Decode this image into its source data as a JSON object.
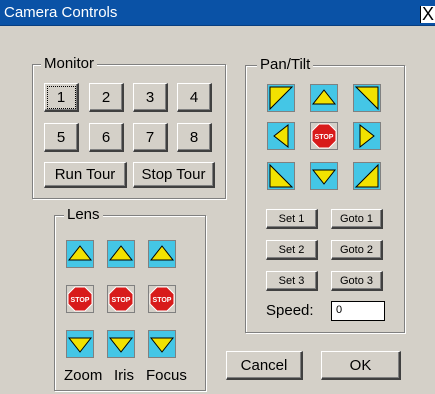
{
  "window": {
    "title": "Camera Controls",
    "close_label": "X"
  },
  "monitor": {
    "label": "Monitor",
    "buttons": [
      "1",
      "2",
      "3",
      "4",
      "5",
      "6",
      "7",
      "8"
    ],
    "run_tour": "Run Tour",
    "stop_tour": "Stop Tour"
  },
  "pantilt": {
    "label": "Pan/Tilt",
    "stop_text": "STOP",
    "set1": "Set 1",
    "goto1": "Goto 1",
    "set2": "Set 2",
    "goto2": "Goto 2",
    "set3": "Set 3",
    "goto3": "Goto 3",
    "speed_label": "Speed:",
    "speed_value": "0"
  },
  "lens": {
    "label": "Lens",
    "stop_text": "STOP",
    "zoom": "Zoom",
    "iris": "Iris",
    "focus": "Focus"
  },
  "actions": {
    "cancel": "Cancel",
    "ok": "OK"
  },
  "colors": {
    "icon_bg": "#44c6e6",
    "arrow": "#f2e200",
    "stop": "#d81b1b",
    "title_bg": "#0a52a6"
  }
}
